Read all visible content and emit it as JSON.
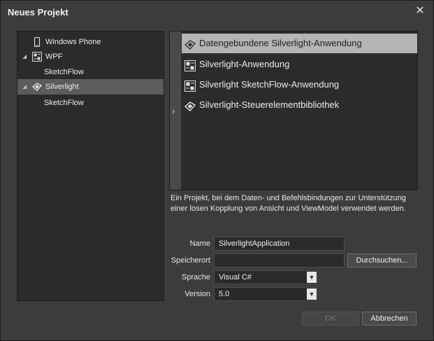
{
  "dialog": {
    "title": "Neues Projekt",
    "close_glyph": "✕"
  },
  "tree": {
    "items": [
      {
        "label": "Windows Phone",
        "icon": "phone-icon",
        "expanded": null
      },
      {
        "label": "WPF",
        "icon": "wpf-icon",
        "expanded": "◢"
      },
      {
        "label": "SketchFlow",
        "icon": null,
        "expanded": null
      },
      {
        "label": "Silverlight",
        "icon": "silverlight-icon",
        "expanded": "◢",
        "selected": true
      },
      {
        "label": "SketchFlow",
        "icon": null,
        "expanded": null
      }
    ]
  },
  "templates": {
    "side_glyph": "›",
    "items": [
      {
        "label": "Datengebundene Silverlight-Anwendung",
        "icon": "silverlight-icon",
        "selected": true
      },
      {
        "label": "Silverlight-Anwendung",
        "icon": "app-window-icon"
      },
      {
        "label": "Silverlight SketchFlow-Anwendung",
        "icon": "app-window-icon"
      },
      {
        "label": "Silverlight-Steuerelementbibliothek",
        "icon": "silverlight-icon"
      }
    ]
  },
  "description": "Ein Projekt, bei dem Daten- und Befehlsbindungen zur Unterstützung einer losen Kopplung von Ansicht und ViewModel verwendet werden.",
  "form": {
    "name_label": "Name",
    "name_value": "SilverlightApplication",
    "location_label": "Speicherort",
    "location_value": "",
    "browse_label": "Durchsuchen...",
    "language_label": "Sprache",
    "language_value": "Visual C#",
    "version_label": "Version",
    "version_value": "5.0",
    "dropdown_glyph": "▼"
  },
  "buttons": {
    "ok": "OK",
    "cancel": "Abbrechen"
  }
}
